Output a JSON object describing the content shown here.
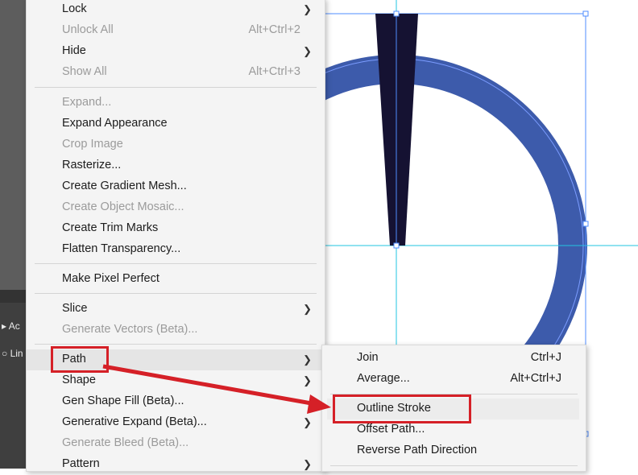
{
  "menu": {
    "items": [
      {
        "label": "Lock",
        "shortcut": "",
        "submenu": true,
        "enabled": true
      },
      {
        "label": "Unlock All",
        "shortcut": "Alt+Ctrl+2",
        "submenu": false,
        "enabled": false
      },
      {
        "label": "Hide",
        "shortcut": "",
        "submenu": true,
        "enabled": true
      },
      {
        "label": "Show All",
        "shortcut": "Alt+Ctrl+3",
        "submenu": false,
        "enabled": false
      },
      {
        "label": "Expand...",
        "shortcut": "",
        "submenu": false,
        "enabled": false
      },
      {
        "label": "Expand Appearance",
        "shortcut": "",
        "submenu": false,
        "enabled": true
      },
      {
        "label": "Crop Image",
        "shortcut": "",
        "submenu": false,
        "enabled": false
      },
      {
        "label": "Rasterize...",
        "shortcut": "",
        "submenu": false,
        "enabled": true
      },
      {
        "label": "Create Gradient Mesh...",
        "shortcut": "",
        "submenu": false,
        "enabled": true
      },
      {
        "label": "Create Object Mosaic...",
        "shortcut": "",
        "submenu": false,
        "enabled": false
      },
      {
        "label": "Create Trim Marks",
        "shortcut": "",
        "submenu": false,
        "enabled": true
      },
      {
        "label": "Flatten Transparency...",
        "shortcut": "",
        "submenu": false,
        "enabled": true
      },
      {
        "label": "Make Pixel Perfect",
        "shortcut": "",
        "submenu": false,
        "enabled": true
      },
      {
        "label": "Slice",
        "shortcut": "",
        "submenu": true,
        "enabled": true
      },
      {
        "label": "Generate Vectors (Beta)...",
        "shortcut": "",
        "submenu": false,
        "enabled": false
      },
      {
        "label": "Path",
        "shortcut": "",
        "submenu": true,
        "enabled": true,
        "highlighted": true
      },
      {
        "label": "Shape",
        "shortcut": "",
        "submenu": true,
        "enabled": true
      },
      {
        "label": "Gen Shape Fill (Beta)...",
        "shortcut": "",
        "submenu": false,
        "enabled": true
      },
      {
        "label": "Generative Expand (Beta)...",
        "shortcut": "",
        "submenu": true,
        "enabled": true
      },
      {
        "label": "Generate Bleed (Beta)...",
        "shortcut": "",
        "submenu": false,
        "enabled": false
      },
      {
        "label": "Pattern",
        "shortcut": "",
        "submenu": true,
        "enabled": true
      }
    ]
  },
  "submenu": {
    "items": [
      {
        "label": "Join",
        "shortcut": "Ctrl+J"
      },
      {
        "label": "Average...",
        "shortcut": "Alt+Ctrl+J"
      },
      {
        "label": "Outline Stroke",
        "shortcut": "",
        "highlighted": true
      },
      {
        "label": "Offset Path...",
        "shortcut": ""
      },
      {
        "label": "Reverse Path Direction",
        "shortcut": ""
      }
    ]
  },
  "panel": {
    "items": [
      {
        "label": "▸ Ac"
      },
      {
        "label": "○ Lin"
      }
    ]
  },
  "colors": {
    "ring": "#3d5bab",
    "needle": "#151232",
    "guide": "#22c4e0",
    "annotation": "#d52027"
  }
}
